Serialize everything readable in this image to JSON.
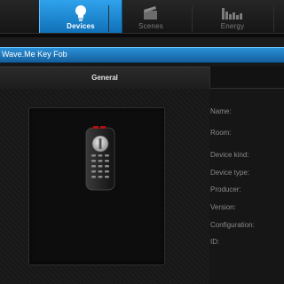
{
  "tabs": [
    {
      "label": "Devices",
      "icon": "lightbulb-icon",
      "active": true
    },
    {
      "label": "Scenes",
      "icon": "clapperboard-icon",
      "active": false
    },
    {
      "label": "Energy",
      "icon": "bar-chart-icon",
      "active": false
    }
  ],
  "device": {
    "title": "Wave.Me Key Fob",
    "section_tab": "General",
    "image": "key-fob-remote-icon"
  },
  "fields": [
    {
      "label": "Name:"
    },
    {
      "label": "Room:"
    },
    {
      "label": "Device kind:"
    },
    {
      "label": "Device type:"
    },
    {
      "label": "Producer:"
    },
    {
      "label": "Version:"
    },
    {
      "label": "Configuration:"
    },
    {
      "label": "ID:"
    }
  ],
  "colors": {
    "accent": "#1e88d6",
    "background": "#1b1b1b",
    "label_text": "#8a8a8a"
  }
}
